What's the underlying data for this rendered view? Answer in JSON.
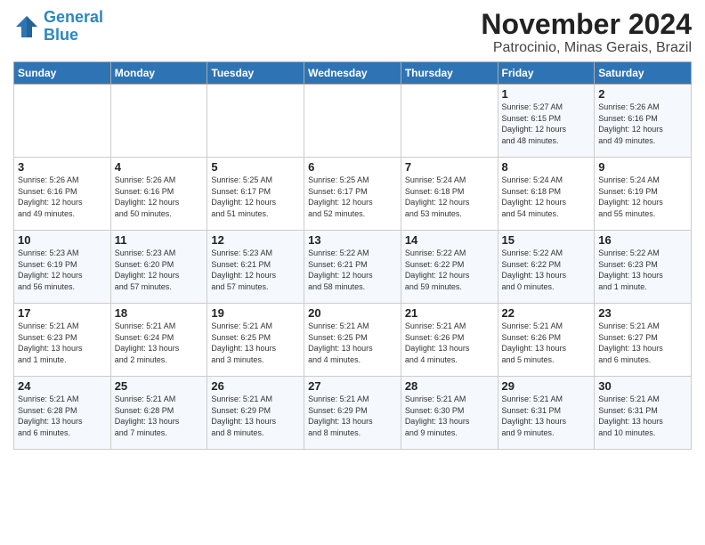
{
  "header": {
    "logo_line1": "General",
    "logo_line2": "Blue",
    "month": "November 2024",
    "location": "Patrocinio, Minas Gerais, Brazil"
  },
  "weekdays": [
    "Sunday",
    "Monday",
    "Tuesday",
    "Wednesday",
    "Thursday",
    "Friday",
    "Saturday"
  ],
  "weeks": [
    [
      {
        "day": "",
        "info": ""
      },
      {
        "day": "",
        "info": ""
      },
      {
        "day": "",
        "info": ""
      },
      {
        "day": "",
        "info": ""
      },
      {
        "day": "",
        "info": ""
      },
      {
        "day": "1",
        "info": "Sunrise: 5:27 AM\nSunset: 6:15 PM\nDaylight: 12 hours\nand 48 minutes."
      },
      {
        "day": "2",
        "info": "Sunrise: 5:26 AM\nSunset: 6:16 PM\nDaylight: 12 hours\nand 49 minutes."
      }
    ],
    [
      {
        "day": "3",
        "info": "Sunrise: 5:26 AM\nSunset: 6:16 PM\nDaylight: 12 hours\nand 49 minutes."
      },
      {
        "day": "4",
        "info": "Sunrise: 5:26 AM\nSunset: 6:16 PM\nDaylight: 12 hours\nand 50 minutes."
      },
      {
        "day": "5",
        "info": "Sunrise: 5:25 AM\nSunset: 6:17 PM\nDaylight: 12 hours\nand 51 minutes."
      },
      {
        "day": "6",
        "info": "Sunrise: 5:25 AM\nSunset: 6:17 PM\nDaylight: 12 hours\nand 52 minutes."
      },
      {
        "day": "7",
        "info": "Sunrise: 5:24 AM\nSunset: 6:18 PM\nDaylight: 12 hours\nand 53 minutes."
      },
      {
        "day": "8",
        "info": "Sunrise: 5:24 AM\nSunset: 6:18 PM\nDaylight: 12 hours\nand 54 minutes."
      },
      {
        "day": "9",
        "info": "Sunrise: 5:24 AM\nSunset: 6:19 PM\nDaylight: 12 hours\nand 55 minutes."
      }
    ],
    [
      {
        "day": "10",
        "info": "Sunrise: 5:23 AM\nSunset: 6:19 PM\nDaylight: 12 hours\nand 56 minutes."
      },
      {
        "day": "11",
        "info": "Sunrise: 5:23 AM\nSunset: 6:20 PM\nDaylight: 12 hours\nand 57 minutes."
      },
      {
        "day": "12",
        "info": "Sunrise: 5:23 AM\nSunset: 6:21 PM\nDaylight: 12 hours\nand 57 minutes."
      },
      {
        "day": "13",
        "info": "Sunrise: 5:22 AM\nSunset: 6:21 PM\nDaylight: 12 hours\nand 58 minutes."
      },
      {
        "day": "14",
        "info": "Sunrise: 5:22 AM\nSunset: 6:22 PM\nDaylight: 12 hours\nand 59 minutes."
      },
      {
        "day": "15",
        "info": "Sunrise: 5:22 AM\nSunset: 6:22 PM\nDaylight: 13 hours\nand 0 minutes."
      },
      {
        "day": "16",
        "info": "Sunrise: 5:22 AM\nSunset: 6:23 PM\nDaylight: 13 hours\nand 1 minute."
      }
    ],
    [
      {
        "day": "17",
        "info": "Sunrise: 5:21 AM\nSunset: 6:23 PM\nDaylight: 13 hours\nand 1 minute."
      },
      {
        "day": "18",
        "info": "Sunrise: 5:21 AM\nSunset: 6:24 PM\nDaylight: 13 hours\nand 2 minutes."
      },
      {
        "day": "19",
        "info": "Sunrise: 5:21 AM\nSunset: 6:25 PM\nDaylight: 13 hours\nand 3 minutes."
      },
      {
        "day": "20",
        "info": "Sunrise: 5:21 AM\nSunset: 6:25 PM\nDaylight: 13 hours\nand 4 minutes."
      },
      {
        "day": "21",
        "info": "Sunrise: 5:21 AM\nSunset: 6:26 PM\nDaylight: 13 hours\nand 4 minutes."
      },
      {
        "day": "22",
        "info": "Sunrise: 5:21 AM\nSunset: 6:26 PM\nDaylight: 13 hours\nand 5 minutes."
      },
      {
        "day": "23",
        "info": "Sunrise: 5:21 AM\nSunset: 6:27 PM\nDaylight: 13 hours\nand 6 minutes."
      }
    ],
    [
      {
        "day": "24",
        "info": "Sunrise: 5:21 AM\nSunset: 6:28 PM\nDaylight: 13 hours\nand 6 minutes."
      },
      {
        "day": "25",
        "info": "Sunrise: 5:21 AM\nSunset: 6:28 PM\nDaylight: 13 hours\nand 7 minutes."
      },
      {
        "day": "26",
        "info": "Sunrise: 5:21 AM\nSunset: 6:29 PM\nDaylight: 13 hours\nand 8 minutes."
      },
      {
        "day": "27",
        "info": "Sunrise: 5:21 AM\nSunset: 6:29 PM\nDaylight: 13 hours\nand 8 minutes."
      },
      {
        "day": "28",
        "info": "Sunrise: 5:21 AM\nSunset: 6:30 PM\nDaylight: 13 hours\nand 9 minutes."
      },
      {
        "day": "29",
        "info": "Sunrise: 5:21 AM\nSunset: 6:31 PM\nDaylight: 13 hours\nand 9 minutes."
      },
      {
        "day": "30",
        "info": "Sunrise: 5:21 AM\nSunset: 6:31 PM\nDaylight: 13 hours\nand 10 minutes."
      }
    ]
  ]
}
